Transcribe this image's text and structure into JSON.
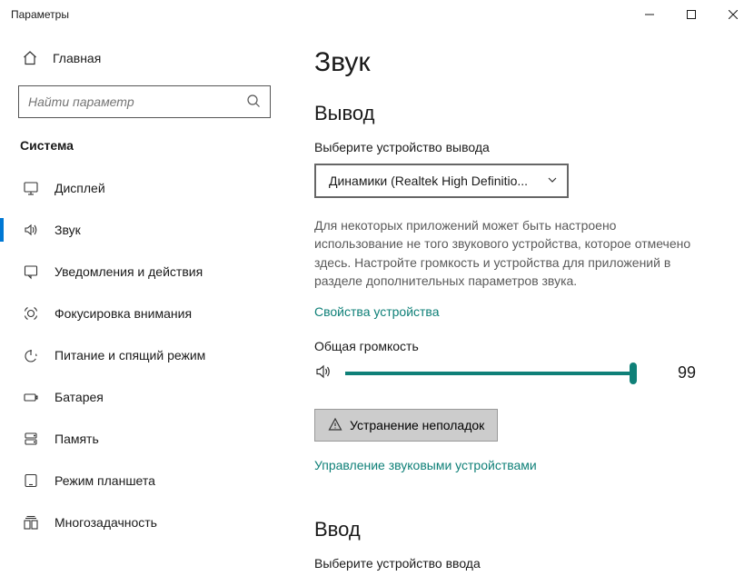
{
  "window": {
    "title": "Параметры"
  },
  "sidebar": {
    "home_label": "Главная",
    "search_placeholder": "Найти параметр",
    "category": "Система",
    "items": [
      {
        "label": "Дисплей",
        "icon": "display",
        "selected": false
      },
      {
        "label": "Звук",
        "icon": "sound",
        "selected": true
      },
      {
        "label": "Уведомления и действия",
        "icon": "notifications",
        "selected": false
      },
      {
        "label": "Фокусировка внимания",
        "icon": "focus",
        "selected": false
      },
      {
        "label": "Питание и спящий режим",
        "icon": "power",
        "selected": false
      },
      {
        "label": "Батарея",
        "icon": "battery",
        "selected": false
      },
      {
        "label": "Память",
        "icon": "storage",
        "selected": false
      },
      {
        "label": "Режим планшета",
        "icon": "tablet",
        "selected": false
      },
      {
        "label": "Многозадачность",
        "icon": "multitasking",
        "selected": false
      }
    ]
  },
  "main": {
    "title": "Звук",
    "output": {
      "heading": "Вывод",
      "choose_label": "Выберите устройство вывода",
      "selected_device": "Динамики (Realtek High Definitio...",
      "description": "Для некоторых приложений может быть настроено использование не того звукового устройства, которое отмечено здесь. Настройте громкость и устройства для приложений в разделе дополнительных параметров звука.",
      "device_props_link": "Свойства устройства",
      "volume_label": "Общая громкость",
      "volume_value": "99",
      "volume_percent": 99,
      "troubleshoot_label": "Устранение неполадок",
      "manage_link": "Управление звуковыми устройствами"
    },
    "input": {
      "heading": "Ввод",
      "choose_label": "Выберите устройство ввода"
    }
  }
}
